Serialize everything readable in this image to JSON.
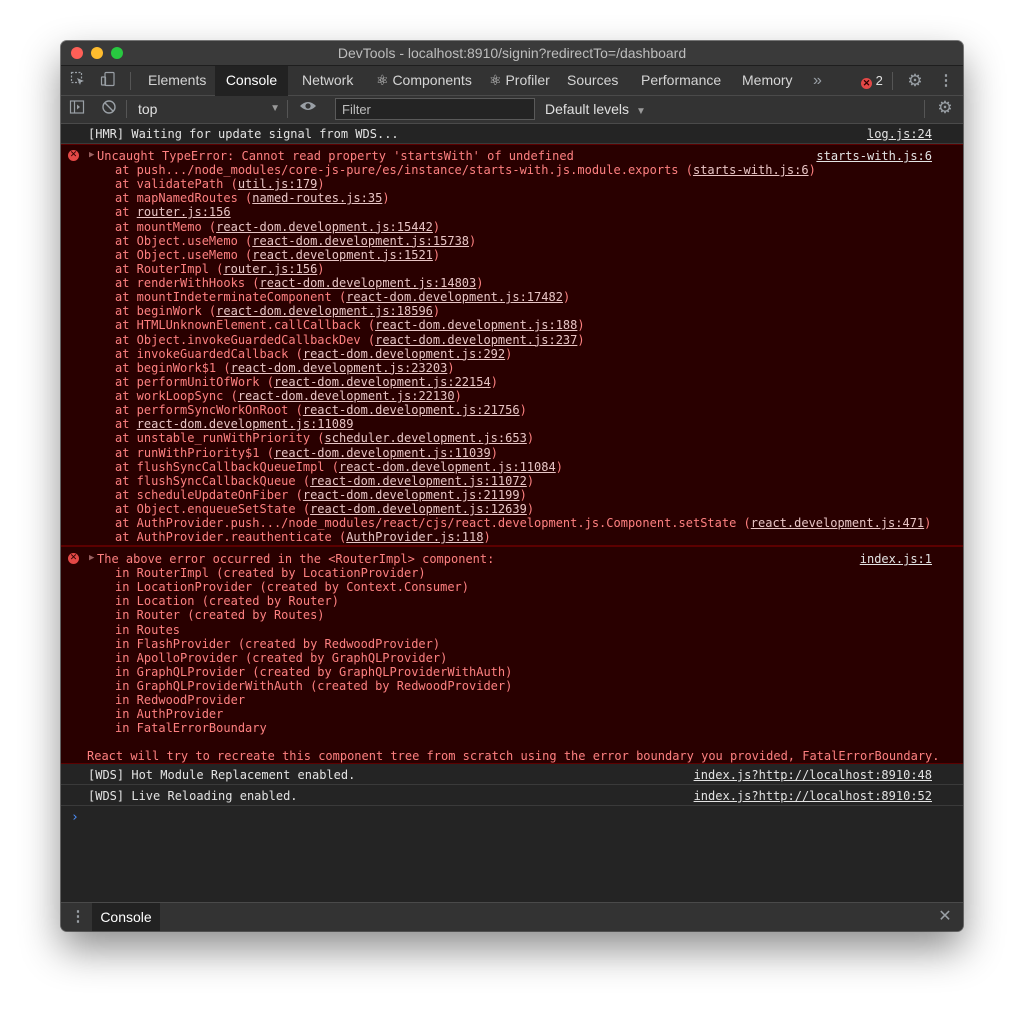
{
  "window": {
    "title": "DevTools - localhost:8910/signin?redirectTo=/dashboard"
  },
  "tabs": [
    "Elements",
    "Console",
    "Network",
    "⚛ Components",
    "⚛ Profiler",
    "Sources",
    "Performance",
    "Memory"
  ],
  "more_tabs_label": "»",
  "error_count": "2",
  "toolbar": {
    "context": "top",
    "filter_placeholder": "Filter",
    "levels": "Default levels"
  },
  "logs": {
    "hmr": {
      "text": "[HMR] Waiting for update signal from WDS...",
      "source": "log.js:24"
    },
    "wds1": {
      "text": "[WDS] Hot Module Replacement enabled.",
      "source": "index.js?http://localhost:8910:48"
    },
    "wds2": {
      "text": "[WDS] Live Reloading enabled.",
      "source": "index.js?http://localhost:8910:52"
    }
  },
  "error1": {
    "message": "Uncaught TypeError: Cannot read property 'startsWith' of undefined",
    "source": "starts-with.js:6",
    "stack": [
      {
        "pre": "at push.../node_modules/core-js-pure/es/instance/starts-with.js.module.exports (",
        "link": "starts-with.js:6",
        "post": ")"
      },
      {
        "pre": "at validatePath (",
        "link": "util.js:179",
        "post": ")"
      },
      {
        "pre": "at mapNamedRoutes (",
        "link": "named-routes.js:35",
        "post": ")"
      },
      {
        "pre": "at ",
        "link": "router.js:156",
        "post": ""
      },
      {
        "pre": "at mountMemo (",
        "link": "react-dom.development.js:15442",
        "post": ")"
      },
      {
        "pre": "at Object.useMemo (",
        "link": "react-dom.development.js:15738",
        "post": ")"
      },
      {
        "pre": "at Object.useMemo (",
        "link": "react.development.js:1521",
        "post": ")"
      },
      {
        "pre": "at RouterImpl (",
        "link": "router.js:156",
        "post": ")"
      },
      {
        "pre": "at renderWithHooks (",
        "link": "react-dom.development.js:14803",
        "post": ")"
      },
      {
        "pre": "at mountIndeterminateComponent (",
        "link": "react-dom.development.js:17482",
        "post": ")"
      },
      {
        "pre": "at beginWork (",
        "link": "react-dom.development.js:18596",
        "post": ")"
      },
      {
        "pre": "at HTMLUnknownElement.callCallback (",
        "link": "react-dom.development.js:188",
        "post": ")"
      },
      {
        "pre": "at Object.invokeGuardedCallbackDev (",
        "link": "react-dom.development.js:237",
        "post": ")"
      },
      {
        "pre": "at invokeGuardedCallback (",
        "link": "react-dom.development.js:292",
        "post": ")"
      },
      {
        "pre": "at beginWork$1 (",
        "link": "react-dom.development.js:23203",
        "post": ")"
      },
      {
        "pre": "at performUnitOfWork (",
        "link": "react-dom.development.js:22154",
        "post": ")"
      },
      {
        "pre": "at workLoopSync (",
        "link": "react-dom.development.js:22130",
        "post": ")"
      },
      {
        "pre": "at performSyncWorkOnRoot (",
        "link": "react-dom.development.js:21756",
        "post": ")"
      },
      {
        "pre": "at ",
        "link": "react-dom.development.js:11089",
        "post": ""
      },
      {
        "pre": "at unstable_runWithPriority (",
        "link": "scheduler.development.js:653",
        "post": ")"
      },
      {
        "pre": "at runWithPriority$1 (",
        "link": "react-dom.development.js:11039",
        "post": ")"
      },
      {
        "pre": "at flushSyncCallbackQueueImpl (",
        "link": "react-dom.development.js:11084",
        "post": ")"
      },
      {
        "pre": "at flushSyncCallbackQueue (",
        "link": "react-dom.development.js:11072",
        "post": ")"
      },
      {
        "pre": "at scheduleUpdateOnFiber (",
        "link": "react-dom.development.js:21199",
        "post": ")"
      },
      {
        "pre": "at Object.enqueueSetState (",
        "link": "react-dom.development.js:12639",
        "post": ")"
      },
      {
        "pre": "at AuthProvider.push.../node_modules/react/cjs/react.development.js.Component.setState (",
        "link": "react.development.js:471",
        "post": ")"
      },
      {
        "pre": "at AuthProvider.reauthenticate (",
        "link": "AuthProvider.js:118",
        "post": ")"
      }
    ]
  },
  "error2": {
    "message": "The above error occurred in the <RouterImpl> component:",
    "source": "index.js:1",
    "stack": [
      "in RouterImpl (created by LocationProvider)",
      "in LocationProvider (created by Context.Consumer)",
      "in Location (created by Router)",
      "in Router (created by Routes)",
      "in Routes",
      "in FlashProvider (created by RedwoodProvider)",
      "in ApolloProvider (created by GraphQLProvider)",
      "in GraphQLProvider (created by GraphQLProviderWithAuth)",
      "in GraphQLProviderWithAuth (created by RedwoodProvider)",
      "in RedwoodProvider",
      "in AuthProvider",
      "in FatalErrorBoundary"
    ],
    "footer": "React will try to recreate this component tree from scratch using the error boundary you provided, FatalErrorBoundary."
  },
  "prompt_symbol": "›",
  "drawer": {
    "tab": "Console",
    "close_symbol": "✕"
  },
  "colors": {
    "error_text": "#fe8080",
    "error_bg": "#290000",
    "panel_bg": "#242424",
    "prompt": "#4d90fe"
  }
}
